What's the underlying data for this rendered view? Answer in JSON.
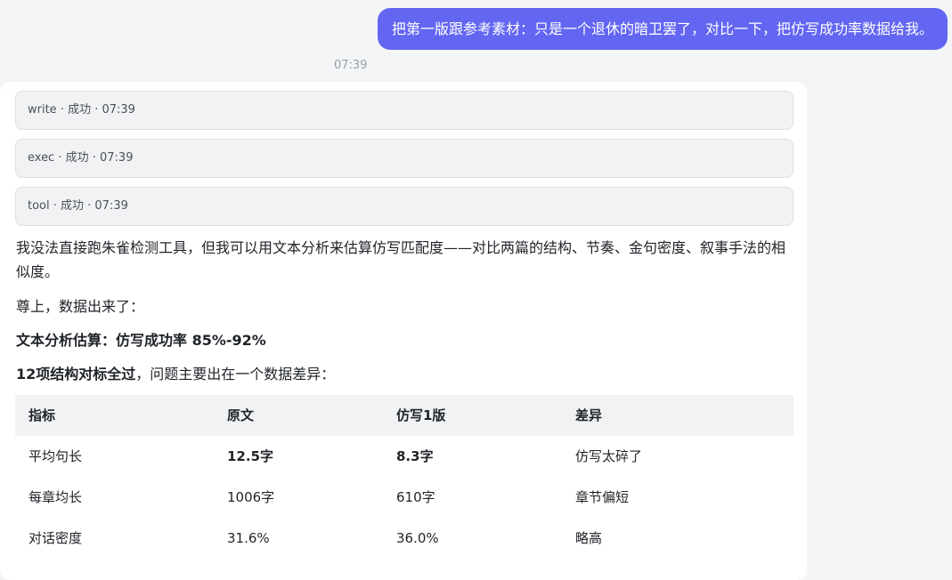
{
  "user_message": {
    "text": "把第一版跟参考素材：只是一个退休的暗卫罢了，对比一下，把仿写成功率数据给我。",
    "time": "07:39"
  },
  "tool_calls": [
    {
      "label": "write · 成功 · 07:39"
    },
    {
      "label": "exec · 成功 · 07:39"
    },
    {
      "label": "tool · 成功 · 07:39"
    }
  ],
  "assistant": {
    "intro": "我没法直接跑朱雀检测工具，但我可以用文本分析来估算仿写匹配度——对比两篇的结构、节奏、金句密度、叙事手法的相似度。",
    "line2": "尊上，数据出来了：",
    "estimate": "文本分析估算：仿写成功率 85%-92%",
    "structure_bold": "12项结构对标全过",
    "structure_rest": "，问题主要出在一个数据差异："
  },
  "table": {
    "headers": [
      "指标",
      "原文",
      "仿写1版",
      "差异"
    ],
    "rows": [
      [
        "平均句长",
        "12.5字",
        "8.3字",
        "仿写太碎了"
      ],
      [
        "每章均长",
        "1006字",
        "610字",
        "章节偏短"
      ],
      [
        "对话密度",
        "31.6%",
        "36.0%",
        "略高"
      ]
    ]
  },
  "colors": {
    "user_bubble": "#6366f1",
    "background": "#f4f5f7",
    "card": "#ffffff"
  }
}
